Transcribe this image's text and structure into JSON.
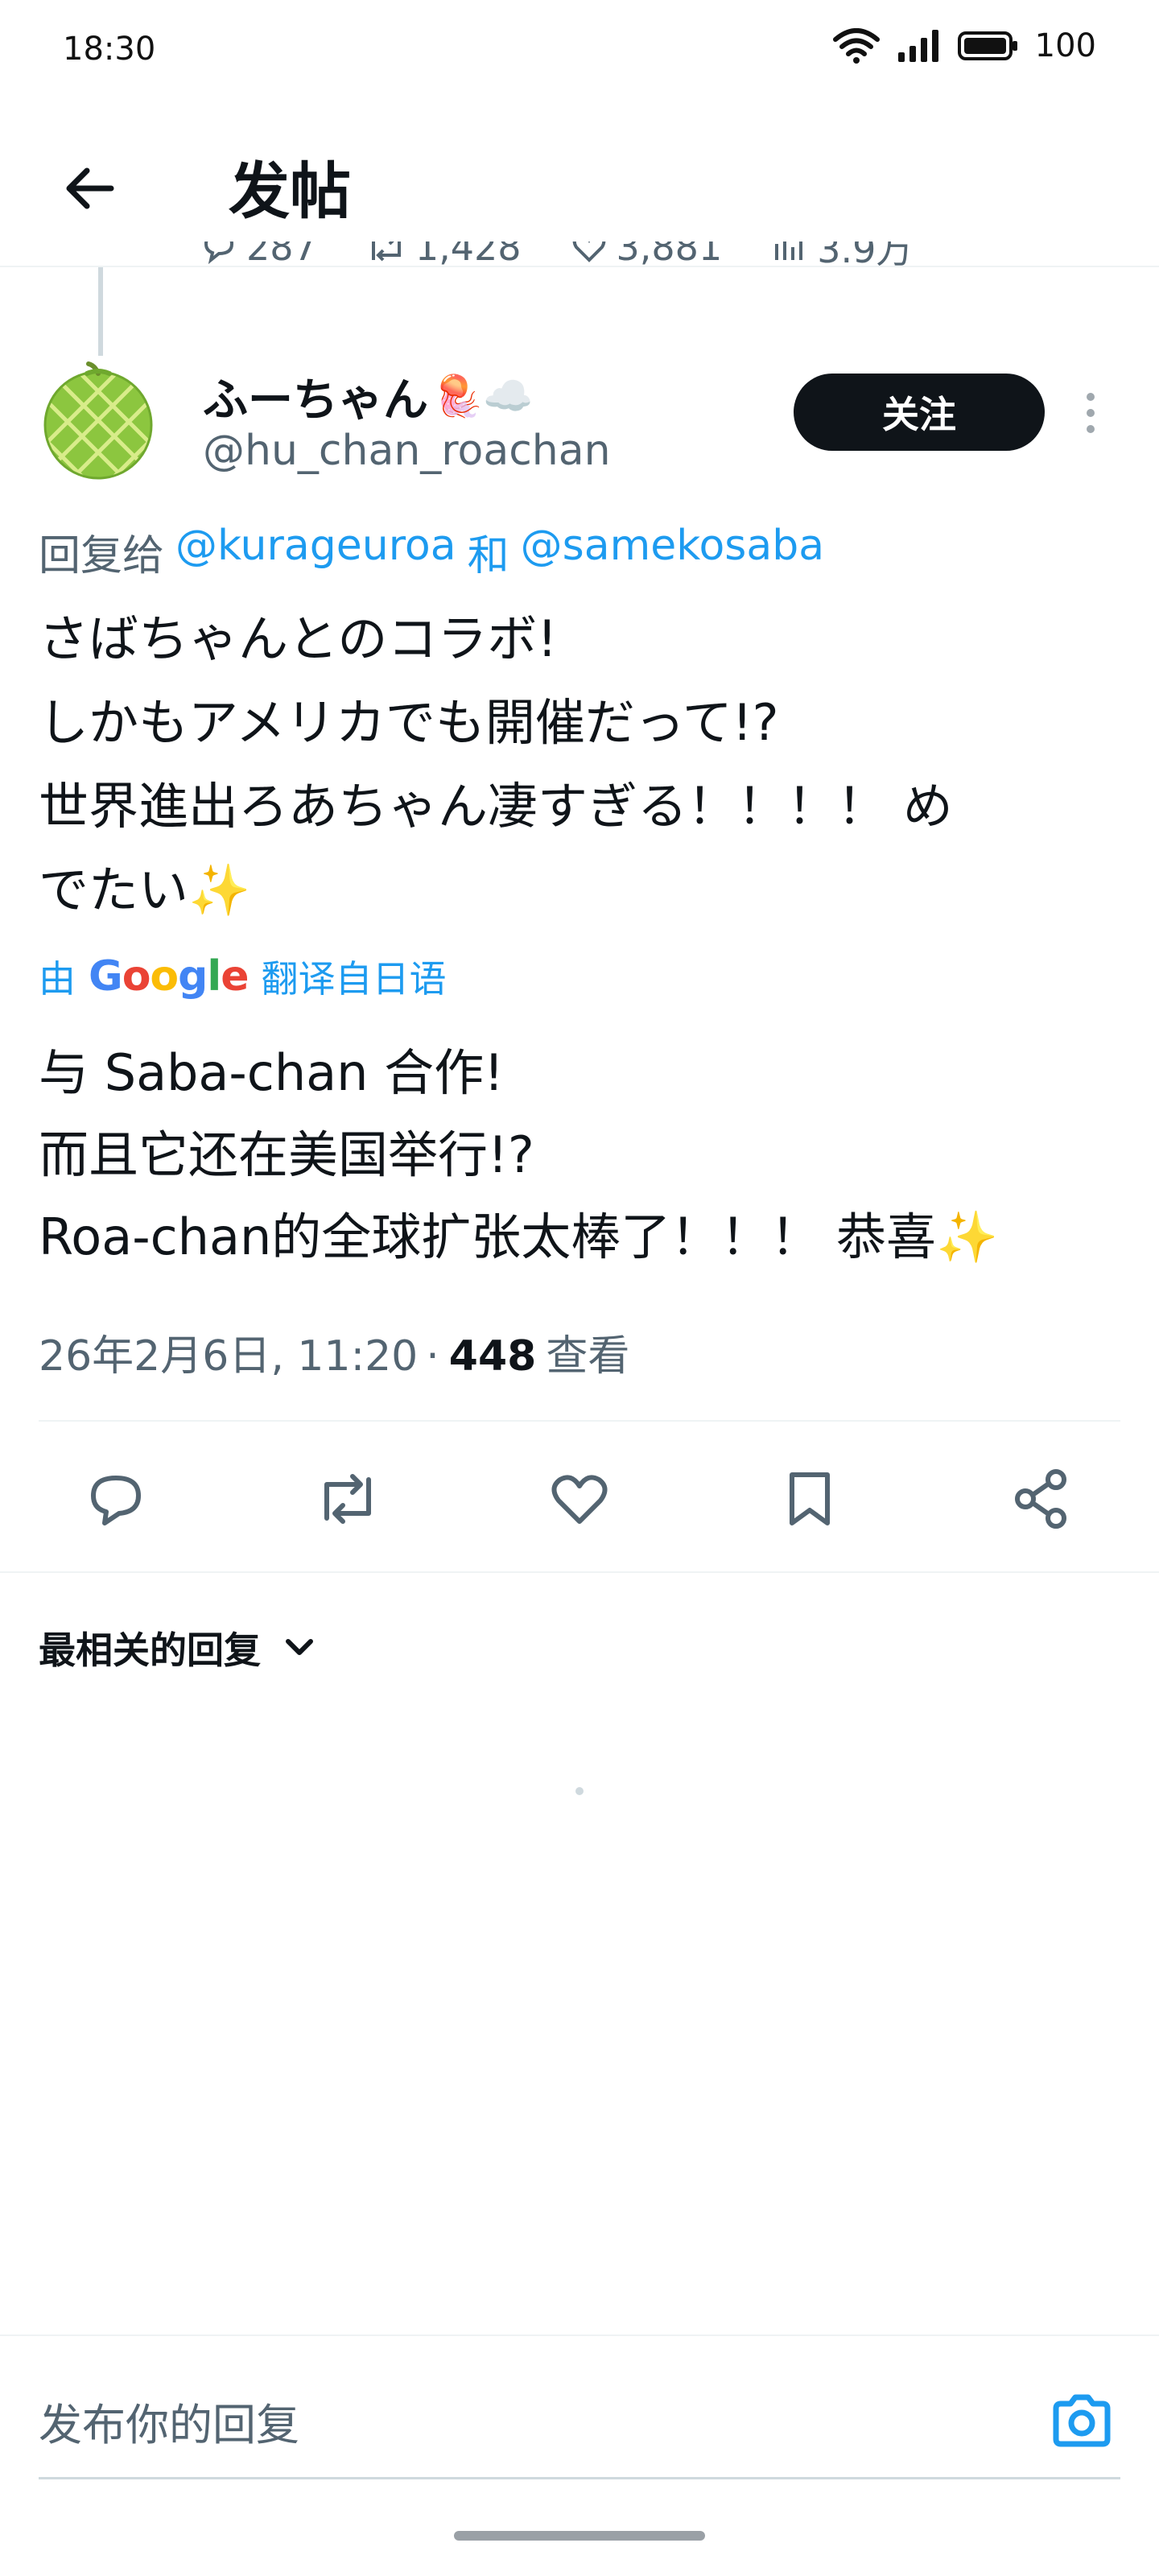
{
  "status_bar": {
    "time": "18:30",
    "battery": "100",
    "icons": [
      "wifi-icon",
      "signal-icon",
      "battery-icon"
    ]
  },
  "header": {
    "title": "发帖",
    "back_icon": "arrow-left-icon"
  },
  "previous_tweet_stats": {
    "replies": "287",
    "reposts": "1,428",
    "likes": "3,881",
    "views": "3.9万"
  },
  "tweet": {
    "author_name": "ふーちゃん",
    "author_emojis": "🪼☁️",
    "author_handle": "@hu_chan_roachan",
    "follow_label": "关注",
    "reply_to_prefix": "回复给",
    "reply_to_mention_1": "@kurageuroa",
    "reply_to_joiner": "和",
    "reply_to_mention_2": "@samekosaba",
    "text_lines": [
      "さばちゃんとのコラボ!",
      "しかもアメリカでも開催だって!?",
      "世界進出ろあちゃん凄すぎる！！！！ め",
      "でたい"
    ],
    "text_trailing_emoji": "✨",
    "translate_prefix": "由",
    "translate_brand": "Google",
    "translate_suffix": "翻译自日语",
    "translated_lines": [
      "与 Saba-chan 合作!",
      "而且它还在美国举行!?",
      "Roa-chan的全球扩张太棒了！！！ 恭喜"
    ],
    "translated_trailing_emoji": "✨",
    "timestamp": "26年2月6日, 11:20",
    "separator": "·",
    "views_count": "448",
    "views_label": "查看"
  },
  "actions": [
    "reply-icon",
    "repost-icon",
    "like-icon",
    "bookmark-icon",
    "share-icon"
  ],
  "replies_section": {
    "sort_label": "最相关的回复"
  },
  "composer": {
    "placeholder": "发布你的回复"
  },
  "colors": {
    "accent": "#1d9bf0",
    "text_primary": "#0f1419",
    "text_secondary": "#536471",
    "follow_bg": "#0f1419"
  }
}
